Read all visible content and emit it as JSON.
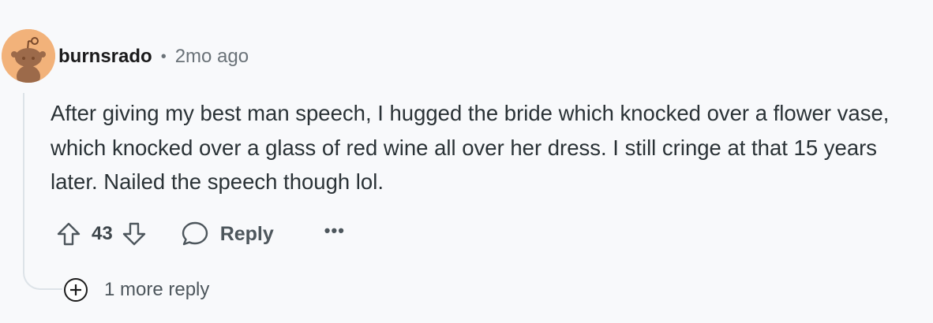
{
  "comment": {
    "author": "burnsrado",
    "separator": "•",
    "time": "2mo ago",
    "body": "After giving my best man speech, I hugged the bride which knocked over a flower vase, which knocked over a glass of red wine all over her dress. I still cringe at that 15 years later. Nailed the speech though lol.",
    "avatar_color": "#f2b27a"
  },
  "actions": {
    "upvote_icon": "upvote-arrow-icon",
    "vote_count": "43",
    "downvote_icon": "downvote-arrow-icon",
    "reply_icon": "speech-bubble-icon",
    "reply_label": "Reply",
    "more_label": "•••"
  },
  "thread": {
    "more_replies_icon": "plus-circle-icon",
    "more_replies_label": "1 more reply"
  }
}
